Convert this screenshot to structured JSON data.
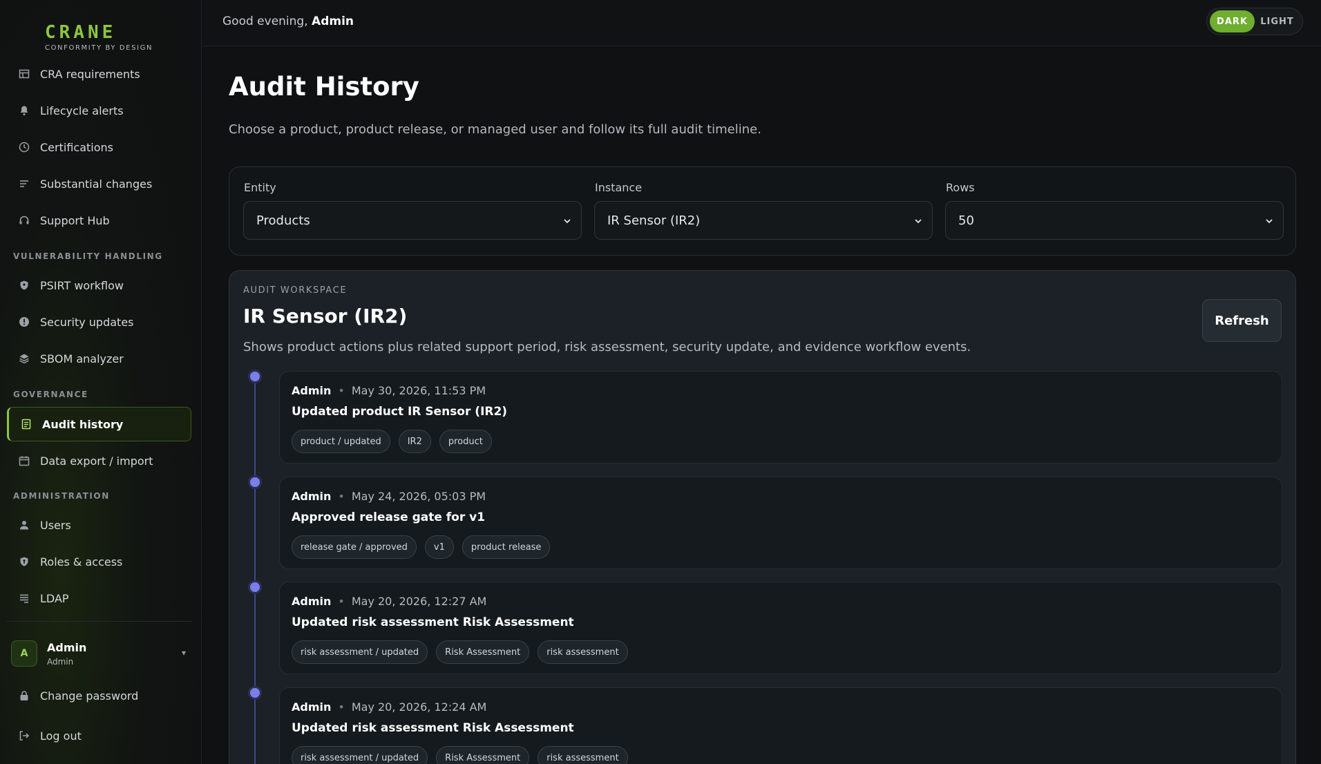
{
  "brand": {
    "name": "CRANE",
    "tagline": "CONFORMITY BY DESIGN"
  },
  "sidebar": {
    "top_items": [
      {
        "label": "CRA requirements",
        "icon": "table-icon"
      },
      {
        "label": "Lifecycle alerts",
        "icon": "bell-icon"
      },
      {
        "label": "Certifications",
        "icon": "clock-icon"
      },
      {
        "label": "Substantial changes",
        "icon": "sort-icon"
      },
      {
        "label": "Support Hub",
        "icon": "headset-icon"
      }
    ],
    "sections": [
      {
        "label": "VULNERABILITY HANDLING"
      },
      {
        "label": "GOVERNANCE"
      },
      {
        "label": "ADMINISTRATION"
      }
    ],
    "vuln_items": [
      {
        "label": "PSIRT workflow",
        "icon": "shield-icon"
      },
      {
        "label": "Security updates",
        "icon": "alert-icon"
      },
      {
        "label": "SBOM analyzer",
        "icon": "layers-icon"
      }
    ],
    "gov_items": [
      {
        "label": "Audit history",
        "icon": "document-icon"
      },
      {
        "label": "Data export / import",
        "icon": "calendar-icon"
      }
    ],
    "admin_items": [
      {
        "label": "Users",
        "icon": "user-icon"
      },
      {
        "label": "Roles & access",
        "icon": "shield-key-icon"
      },
      {
        "label": "LDAP",
        "icon": "list-icon"
      }
    ],
    "user": {
      "initial": "A",
      "name": "Admin",
      "role": "Admin"
    },
    "bottom_items": [
      {
        "label": "Change password",
        "icon": "lock-icon"
      },
      {
        "label": "Log out",
        "icon": "logout-icon"
      }
    ]
  },
  "topbar": {
    "greeting_prefix": "Good evening,",
    "greeting_name": "Admin",
    "theme_dark": "DARK",
    "theme_light": "LIGHT"
  },
  "page": {
    "title": "Audit History",
    "subtitle": "Choose a product, product release, or managed user and follow its full audit timeline."
  },
  "filters": {
    "entity": {
      "label": "Entity",
      "value": "Products"
    },
    "instance": {
      "label": "Instance",
      "value": "IR Sensor (IR2)"
    },
    "rows": {
      "label": "Rows",
      "value": "50"
    }
  },
  "workspace": {
    "label": "AUDIT WORKSPACE",
    "title": "IR Sensor (IR2)",
    "description": "Shows product actions plus related support period, risk assessment, security update, and evidence workflow events.",
    "refresh_label": "Refresh"
  },
  "events": [
    {
      "actor": "Admin",
      "time": "May 30, 2026, 11:53 PM",
      "title": "Updated product IR Sensor (IR2)",
      "tags": [
        "product / updated",
        "IR2",
        "product"
      ]
    },
    {
      "actor": "Admin",
      "time": "May 24, 2026, 05:03 PM",
      "title": "Approved release gate for v1",
      "tags": [
        "release gate / approved",
        "v1",
        "product release"
      ]
    },
    {
      "actor": "Admin",
      "time": "May 20, 2026, 12:27 AM",
      "title": "Updated risk assessment Risk Assessment",
      "tags": [
        "risk assessment / updated",
        "Risk Assessment",
        "risk assessment"
      ]
    },
    {
      "actor": "Admin",
      "time": "May 20, 2026, 12:24 AM",
      "title": "Updated risk assessment Risk Assessment",
      "tags": [
        "risk assessment / updated",
        "Risk Assessment",
        "risk assessment"
      ]
    }
  ],
  "colors": {
    "accent": "#8dc63f",
    "timeline": "#7b7fe8"
  }
}
